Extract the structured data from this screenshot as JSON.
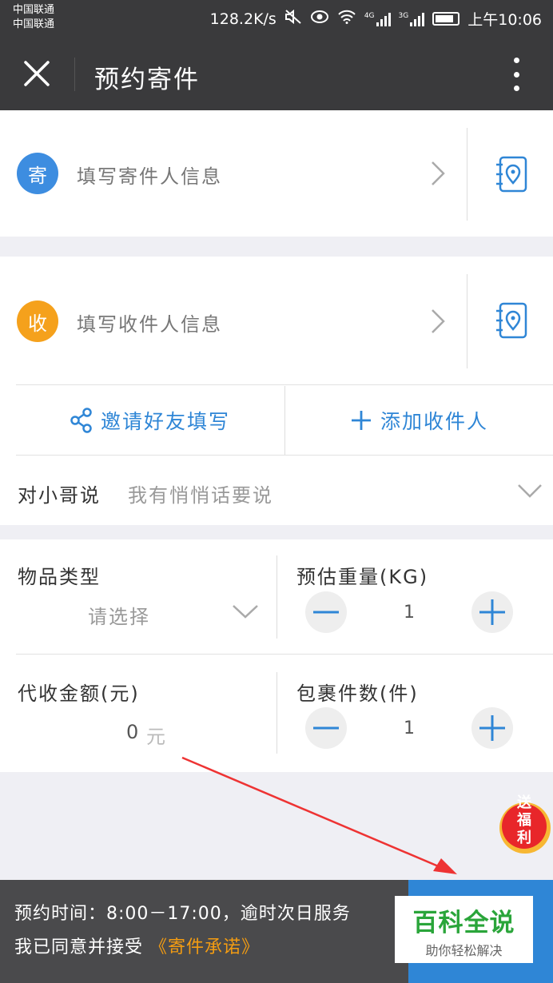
{
  "status_bar": {
    "carrier_1": "中国联通",
    "carrier_2": "中国联通",
    "net_speed": "128.2K/s",
    "net_4g": "4G",
    "net_3g": "3G",
    "time": "上午10:06"
  },
  "header": {
    "title": "预约寄件",
    "close_icon": "close-icon",
    "more_icon": "more-vertical-icon"
  },
  "sender": {
    "badge": "寄",
    "badge_color": "#3d8de0",
    "placeholder": "填写寄件人信息",
    "icon": "address-book-icon"
  },
  "receiver": {
    "badge": "收",
    "badge_color": "#f5a11c",
    "placeholder": "填写收件人信息",
    "icon": "address-book-icon"
  },
  "actions": {
    "invite_label": "邀请好友填写",
    "add_receiver_label": "添加收件人"
  },
  "message": {
    "label": "对小哥说",
    "placeholder": "我有悄悄话要说"
  },
  "item_type": {
    "label": "物品类型",
    "value": "请选择"
  },
  "weight": {
    "label": "预估重量(KG)",
    "value": "1"
  },
  "cod": {
    "label": "代收金额(元)",
    "value": "0",
    "unit": "元"
  },
  "parcels": {
    "label": "包裹件数(件)",
    "value": "1"
  },
  "promo": {
    "line1": "送",
    "line2": "福",
    "line3": "利"
  },
  "footer": {
    "line1": "预约时间：8:00－17:00，逾时次日服务",
    "line2_prefix": "我已同意并接受",
    "line2_link": "《寄件承诺》"
  },
  "watermark": {
    "main": "百科全说",
    "sub": "助你轻松解决"
  },
  "colors": {
    "accent": "#2f86d6",
    "link_orange": "#f39c12",
    "header_bg": "#3a3a3c"
  }
}
